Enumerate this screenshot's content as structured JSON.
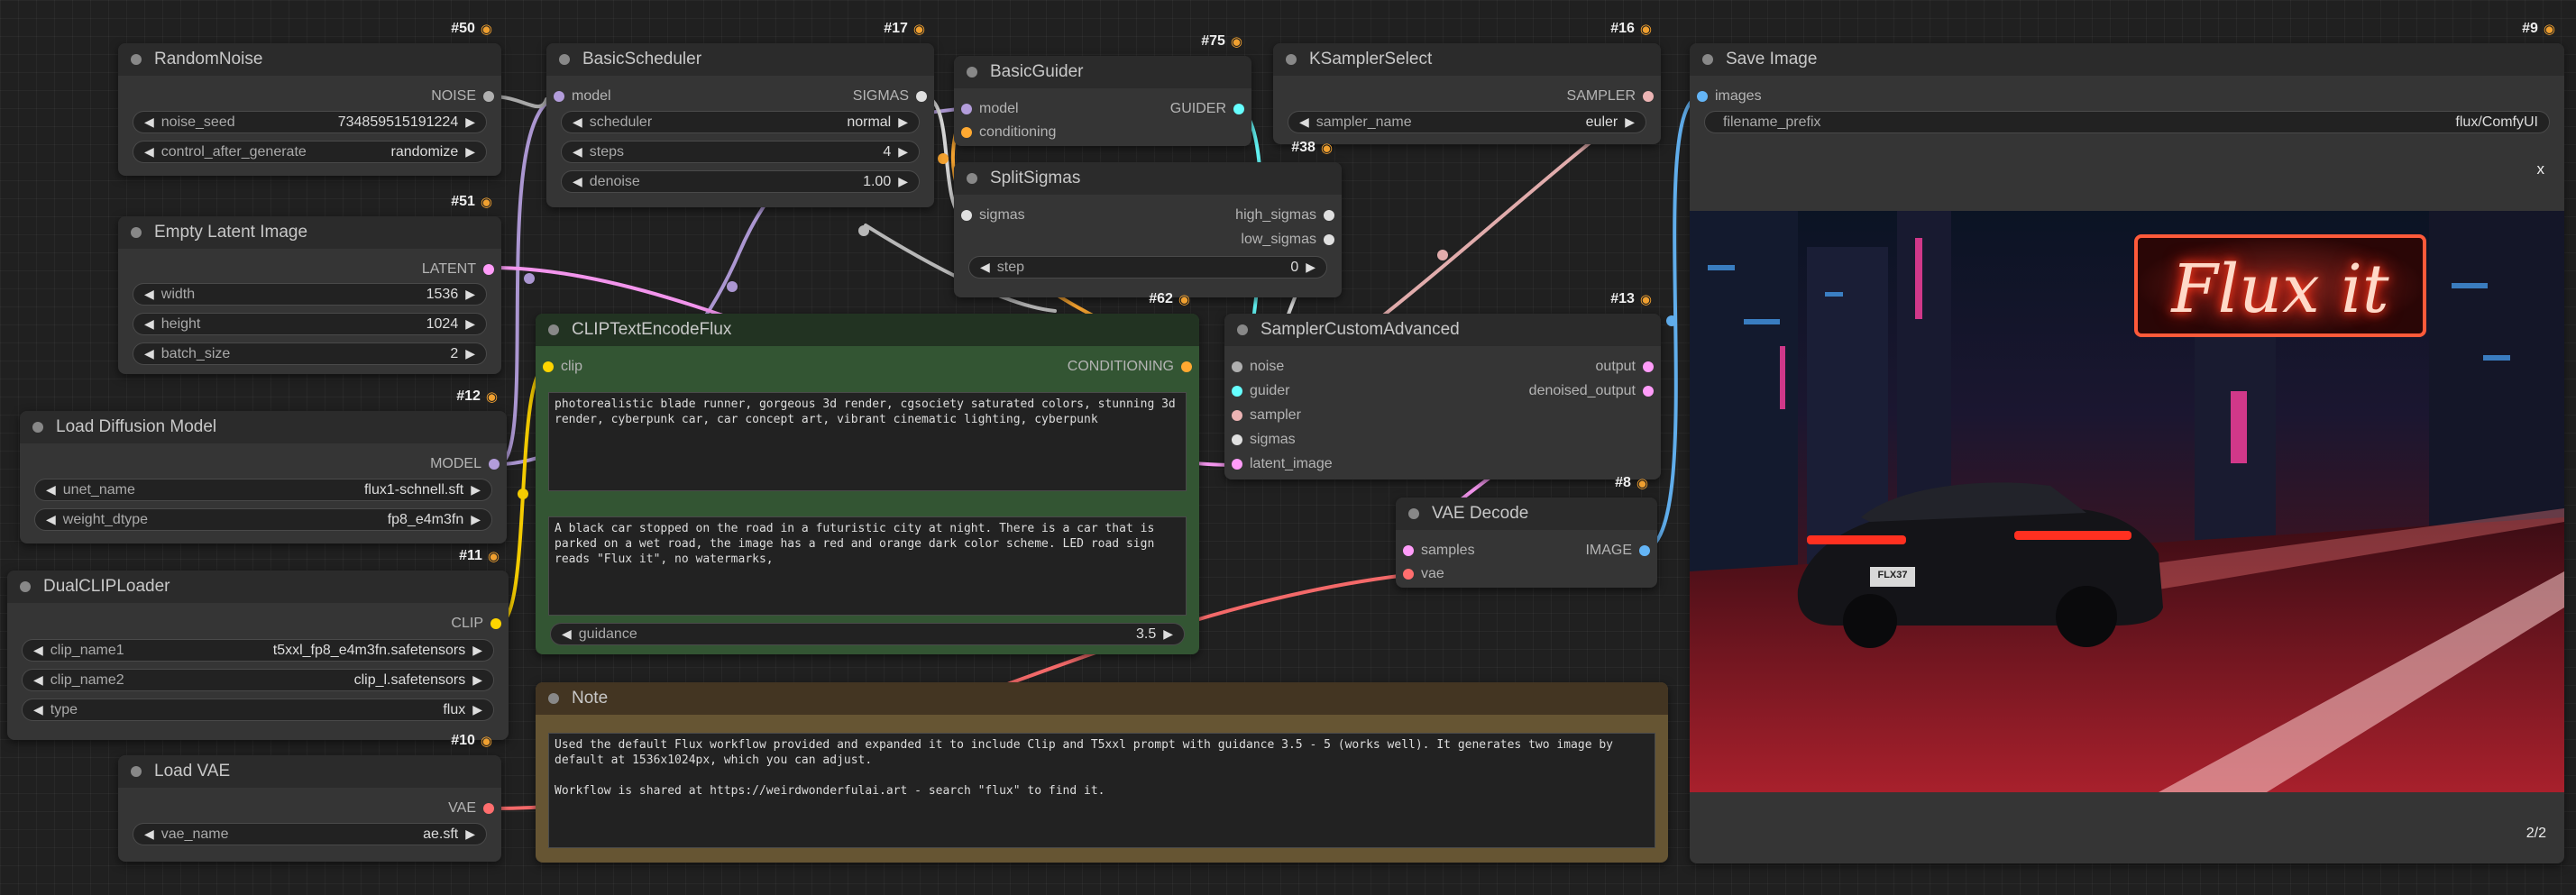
{
  "nodes": {
    "random_noise": {
      "title": "RandomNoise",
      "id": "#50",
      "outputs": [
        "NOISE"
      ],
      "widgets": [
        {
          "label": "noise_seed",
          "value": "734859515191224"
        },
        {
          "label": "control_after_generate",
          "value": "randomize"
        }
      ]
    },
    "basic_scheduler": {
      "title": "BasicScheduler",
      "id": "#17",
      "inputs": [
        "model"
      ],
      "outputs": [
        "SIGMAS"
      ],
      "widgets": [
        {
          "label": "scheduler",
          "value": "normal"
        },
        {
          "label": "steps",
          "value": "4"
        },
        {
          "label": "denoise",
          "value": "1.00"
        }
      ]
    },
    "basic_guider": {
      "title": "BasicGuider",
      "id": "#75",
      "inputs": [
        "model",
        "conditioning"
      ],
      "outputs": [
        "GUIDER"
      ]
    },
    "ksampler_select": {
      "title": "KSamplerSelect",
      "id": "#16",
      "outputs": [
        "SAMPLER"
      ],
      "widgets": [
        {
          "label": "sampler_name",
          "value": "euler"
        }
      ]
    },
    "save_image": {
      "title": "Save Image",
      "id": "#9",
      "inputs": [
        "images"
      ],
      "widgets": [
        {
          "label": "filename_prefix",
          "value": "flux/ComfyUI"
        }
      ],
      "close_label": "x",
      "counter": "2/2",
      "preview_sign": "Flux it",
      "preview_plate": "FLX37"
    },
    "empty_latent": {
      "title": "Empty Latent Image",
      "id": "#51",
      "outputs": [
        "LATENT"
      ],
      "widgets": [
        {
          "label": "width",
          "value": "1536"
        },
        {
          "label": "height",
          "value": "1024"
        },
        {
          "label": "batch_size",
          "value": "2"
        }
      ]
    },
    "split_sigmas": {
      "title": "SplitSigmas",
      "id": "#38",
      "inputs": [
        "sigmas"
      ],
      "outputs": [
        "high_sigmas",
        "low_sigmas"
      ],
      "widgets": [
        {
          "label": "step",
          "value": "0"
        }
      ]
    },
    "clip_text_encode": {
      "title": "CLIPTextEncodeFlux",
      "id": "#62",
      "inputs": [
        "clip"
      ],
      "outputs": [
        "CONDITIONING"
      ],
      "clip_l_text": "photorealistic blade runner, gorgeous 3d render, cgsociety saturated colors, stunning 3d render, cyberpunk car, car concept art, vibrant cinematic lighting, cyberpunk",
      "t5xxl_text": "A black car stopped on the road in a futuristic city at night. There is a car that is parked on a wet road, the image has a red and orange dark color scheme. LED road sign reads \"Flux it\", no watermarks,",
      "widgets": [
        {
          "label": "guidance",
          "value": "3.5"
        }
      ]
    },
    "sampler_custom_advanced": {
      "title": "SamplerCustomAdvanced",
      "id": "#13",
      "inputs": [
        "noise",
        "guider",
        "sampler",
        "sigmas",
        "latent_image"
      ],
      "outputs": [
        "output",
        "denoised_output"
      ]
    },
    "load_diffusion": {
      "title": "Load Diffusion Model",
      "id": "#12",
      "outputs": [
        "MODEL"
      ],
      "widgets": [
        {
          "label": "unet_name",
          "value": "flux1-schnell.sft"
        },
        {
          "label": "weight_dtype",
          "value": "fp8_e4m3fn"
        }
      ]
    },
    "vae_decode": {
      "title": "VAE Decode",
      "id": "#8",
      "inputs": [
        "samples",
        "vae"
      ],
      "outputs": [
        "IMAGE"
      ]
    },
    "dual_clip": {
      "title": "DualCLIPLoader",
      "id": "#11",
      "outputs": [
        "CLIP"
      ],
      "widgets": [
        {
          "label": "clip_name1",
          "value": "t5xxl_fp8_e4m3fn.safetensors"
        },
        {
          "label": "clip_name2",
          "value": "clip_l.safetensors"
        },
        {
          "label": "type",
          "value": "flux"
        }
      ]
    },
    "note": {
      "title": "Note",
      "text": "Used the default Flux workflow provided and expanded it to include Clip and T5xxl prompt with guidance 3.5 - 5 (works well). It generates two image by default at 1536x1024px, which you can adjust.\n\nWorkflow is shared at https://weirdwonderfulai.art - search \"flux\" to find it."
    },
    "load_vae": {
      "title": "Load VAE",
      "id": "#10",
      "outputs": [
        "VAE"
      ],
      "widgets": [
        {
          "label": "vae_name",
          "value": "ae.sft"
        }
      ]
    }
  },
  "colors": {
    "noise": "#b0b0b0",
    "model": "#b39ddb",
    "sigmas": "#e0e0e0",
    "conditioning": "#ffa931",
    "guider": "#66ffff",
    "sampler": "#ecb4b4",
    "latent": "#ff9cf9",
    "clip": "#ffd500",
    "vae": "#ff6e6e",
    "image": "#64b5f6",
    "clip_node_bg": "#335533",
    "note_bg": "#432"
  },
  "icons": {
    "badge": "fox-icon",
    "arrow_left": "arrow-left-icon",
    "arrow_right": "arrow-right-icon"
  }
}
